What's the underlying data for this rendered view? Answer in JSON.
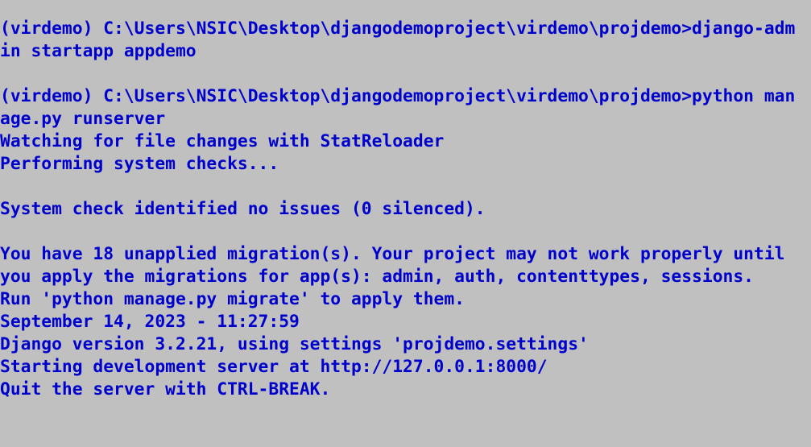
{
  "console": {
    "lines": [
      "(virdemo) C:\\Users\\NSIC\\Desktop\\djangodemoproject\\virdemo\\projdemo>django-adm",
      "in startapp appdemo",
      "",
      "(virdemo) C:\\Users\\NSIC\\Desktop\\djangodemoproject\\virdemo\\projdemo>python man",
      "age.py runserver",
      "Watching for file changes with StatReloader",
      "Performing system checks...",
      "",
      "System check identified no issues (0 silenced).",
      "",
      "You have 18 unapplied migration(s). Your project may not work properly until",
      "you apply the migrations for app(s): admin, auth, contenttypes, sessions.",
      "Run 'python manage.py migrate' to apply them.",
      "September 14, 2023 - 11:27:59",
      "Django version 3.2.21, using settings 'projdemo.settings'",
      "Starting development server at http://127.0.0.1:8000/",
      "Quit the server with CTRL-BREAK."
    ]
  },
  "colors": {
    "background": "#c0c0c0",
    "text": "#0000cc"
  }
}
